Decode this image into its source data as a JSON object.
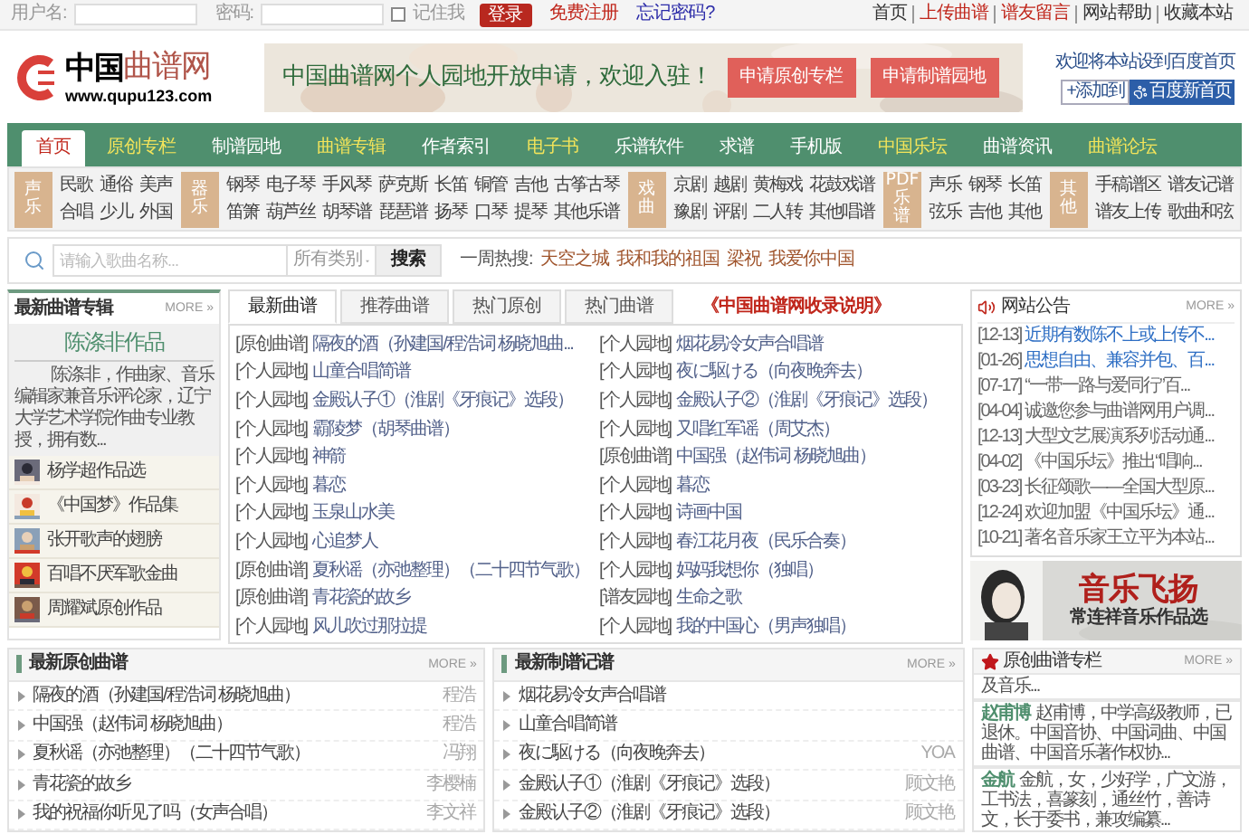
{
  "top_bar": {
    "username_label": "用户名:",
    "password_label": "密码:",
    "remember": {
      "label": "记住我",
      "checked": false
    },
    "login_button": "登录",
    "register_link": "免费注册",
    "forgot_link": "忘记密码?",
    "links": [
      {
        "label": "首页",
        "highlighted": false
      },
      {
        "label": "上传曲谱",
        "highlighted": true
      },
      {
        "label": "谱友留言",
        "highlighted": true
      },
      {
        "label": "网站帮助",
        "highlighted": false
      },
      {
        "label": "收藏本站",
        "highlighted": false
      }
    ]
  },
  "header": {
    "logo": {
      "name_a": "中国",
      "name_b": "曲谱网",
      "url": "www.qupu123.com"
    },
    "banner": {
      "slogan": "中国曲谱网个人园地开放申请，欢迎入驻！",
      "buttons": [
        "申请原创专栏",
        "申请制谱园地"
      ]
    },
    "homepage": {
      "text": "欢迎将本站设到百度首页",
      "add_button": "+添加到",
      "baidu_button": "百度新首页"
    }
  },
  "nav": [
    {
      "label": "首页",
      "selected": true,
      "highlighted": false
    },
    {
      "label": "原创专栏",
      "selected": false,
      "highlighted": true
    },
    {
      "label": "制谱园地",
      "selected": false,
      "highlighted": false
    },
    {
      "label": "曲谱专辑",
      "selected": false,
      "highlighted": true
    },
    {
      "label": "作者索引",
      "selected": false,
      "highlighted": false
    },
    {
      "label": "电子书",
      "selected": false,
      "highlighted": true
    },
    {
      "label": "乐谱软件",
      "selected": false,
      "highlighted": false
    },
    {
      "label": "求谱",
      "selected": false,
      "highlighted": false
    },
    {
      "label": "手机版",
      "selected": false,
      "highlighted": false
    },
    {
      "label": "中国乐坛",
      "selected": false,
      "highlighted": true
    },
    {
      "label": "曲谱资讯",
      "selected": false,
      "highlighted": false
    },
    {
      "label": "曲谱论坛",
      "selected": false,
      "highlighted": true
    }
  ],
  "categories": [
    {
      "label": "声乐",
      "rows": [
        [
          "民歌",
          "通俗",
          "美声"
        ],
        [
          "合唱",
          "少儿",
          "外国"
        ]
      ]
    },
    {
      "label": "器乐",
      "rows": [
        [
          "钢琴",
          "电子琴",
          "手风琴",
          "萨克斯",
          "长笛",
          "铜管",
          "吉他",
          "古筝古琴"
        ],
        [
          "笛箫",
          "葫芦丝",
          "胡琴谱",
          "琵琶谱",
          "扬琴",
          "口琴",
          "提琴",
          "其他乐谱"
        ]
      ]
    },
    {
      "label": "戏曲",
      "rows": [
        [
          "京剧",
          "越剧",
          "黄梅戏",
          "花鼓戏谱"
        ],
        [
          "豫剧",
          "评剧",
          "二人转",
          "其他唱谱"
        ]
      ]
    },
    {
      "label": "PDF乐谱",
      "rows": [
        [
          "声乐",
          "钢琴",
          "长笛"
        ],
        [
          "弦乐",
          "吉他",
          "其他"
        ]
      ]
    },
    {
      "label": "其他",
      "rows": [
        [
          "手稿谱区",
          "谱友记谱"
        ],
        [
          "谱友上传",
          "歌曲和弦"
        ]
      ]
    }
  ],
  "search": {
    "placeholder": "请输入歌曲名称...",
    "category": "所有类别",
    "button": "搜索",
    "hot_label": "一周热搜:",
    "hot": [
      "天空之城",
      "我和我的祖国",
      "梁祝",
      "我爱你中国"
    ]
  },
  "album": {
    "title": "最新曲谱专辑",
    "more": "MORE »",
    "feature_title": "陈涤非作品",
    "feature_text": "陈涤非，作曲家、音乐编辑家兼音乐评论家，辽宁大学艺术学院作曲专业教授，拥有数...",
    "items": [
      "杨学超作品选",
      "《中国梦》作品集",
      "张开歌声的翅膀",
      "百唱不厌军歌金曲",
      "周耀斌原创作品"
    ]
  },
  "scores": {
    "tabs": [
      {
        "label": "最新曲谱",
        "selected": true
      },
      {
        "label": "推荐曲谱",
        "selected": false
      },
      {
        "label": "热门原创",
        "selected": false
      },
      {
        "label": "热门曲谱",
        "selected": false
      }
    ],
    "notice_link": "《中国曲谱网收录说明》",
    "columns": [
      [
        {
          "tag": "[原创曲谱]",
          "title": "隔夜的酒（孙建国/程浩词 杨晓旭曲..."
        },
        {
          "tag": "[个人园地]",
          "title": "山童合唱简谱"
        },
        {
          "tag": "[个人园地]",
          "title": "金殿认子①（淮剧《牙痕记》选段）"
        },
        {
          "tag": "[个人园地]",
          "title": "霸陵梦（胡琴曲谱）"
        },
        {
          "tag": "[个人园地]",
          "title": "神箭"
        },
        {
          "tag": "[个人园地]",
          "title": "暮恋"
        },
        {
          "tag": "[个人园地]",
          "title": "玉泉山水美"
        },
        {
          "tag": "[个人园地]",
          "title": "心追梦人"
        },
        {
          "tag": "[原创曲谱]",
          "title": "夏秋谣（亦弛整理）（二十四节气歌）"
        },
        {
          "tag": "[原创曲谱]",
          "title": "青花瓷的故乡"
        },
        {
          "tag": "[个人园地]",
          "title": "风儿吹过那拉提"
        }
      ],
      [
        {
          "tag": "[个人园地]",
          "title": "烟花易冷女声合唱谱"
        },
        {
          "tag": "[个人园地]",
          "title": "夜に駆ける（向夜晚奔去）"
        },
        {
          "tag": "[个人园地]",
          "title": "金殿认子②（淮剧《牙痕记》选段）"
        },
        {
          "tag": "[个人园地]",
          "title": "又唱红军谣（周艾杰）"
        },
        {
          "tag": "[原创曲谱]",
          "title": "中国强（赵伟词 杨晓旭曲）"
        },
        {
          "tag": "[个人园地]",
          "title": "暮恋"
        },
        {
          "tag": "[个人园地]",
          "title": "诗画中国"
        },
        {
          "tag": "[个人园地]",
          "title": "春江花月夜（民乐合奏）"
        },
        {
          "tag": "[个人园地]",
          "title": "妈妈我想你（独唱）"
        },
        {
          "tag": "[谱友园地]",
          "title": "生命之歌"
        },
        {
          "tag": "[个人园地]",
          "title": "我的中国心（男声独唱）"
        }
      ]
    ]
  },
  "announcements": {
    "title": "网站公告",
    "more": "MORE »",
    "items": [
      {
        "date": "[12-13]",
        "title": "近期有数陈不上或上传不...",
        "highlighted": true
      },
      {
        "date": "[01-26]",
        "title": "思想自由、兼容并包、百...",
        "highlighted": true
      },
      {
        "date": "[07-17]",
        "title": "“一带一路与爱同行”百...",
        "highlighted": false
      },
      {
        "date": "[04-04]",
        "title": "诚邀您参与曲谱网用户调...",
        "highlighted": false
      },
      {
        "date": "[12-13]",
        "title": "大型文艺展演系列活动通...",
        "highlighted": false
      },
      {
        "date": "[04-02]",
        "title": "《中国乐坛》推出“唱响...",
        "highlighted": false
      },
      {
        "date": "[03-23]",
        "title": "长征颂歌——全国大型原...",
        "highlighted": false
      },
      {
        "date": "[12-24]",
        "title": "欢迎加盟《中国乐坛》通...",
        "highlighted": false
      },
      {
        "date": "[10-21]",
        "title": "著名音乐家王立平为本站...",
        "highlighted": false
      }
    ],
    "ad": {
      "title": "音乐飞扬",
      "subtitle": "常连祥音乐作品选"
    }
  },
  "latest_original": {
    "title": "最新原创曲谱",
    "more": "MORE »",
    "rows": [
      {
        "title": "隔夜的酒（孙建国/程浩词 杨晓旭曲）",
        "author": "程浩"
      },
      {
        "title": "中国强（赵伟词 杨晓旭曲）",
        "author": "程浩"
      },
      {
        "title": "夏秋谣（亦弛整理）（二十四节气歌）",
        "author": "冯翔"
      },
      {
        "title": "青花瓷的故乡",
        "author": "李樱楠"
      },
      {
        "title": "我的祝福你听见了吗（女声合唱）",
        "author": "李文祥"
      }
    ]
  },
  "latest_transcribed": {
    "title": "最新制谱记谱",
    "more": "MORE »",
    "rows": [
      {
        "title": "烟花易冷女声合唱谱"
      },
      {
        "title": "山童合唱简谱"
      },
      {
        "title": "夜に駆ける（向夜晚奔去）",
        "author": "YOA"
      },
      {
        "title": "金殿认子①（淮剧《牙痕记》选段）",
        "author": "顾文艳"
      },
      {
        "title": "金殿认子②（淮剧《牙痕记》选段）",
        "author": "顾文艳"
      }
    ]
  },
  "columnists": {
    "title": "原创曲谱专栏",
    "more": "MORE »",
    "entries": [
      {
        "text": "及音乐..."
      },
      {
        "name": "赵甫博",
        "text": "赵甫博，中学高级教师，已退休。中国音协、中国词曲、中国曲谱、中国音乐著作权协..."
      },
      {
        "name": "金航",
        "text": "金航，女，少好学，广文游，工书法，喜篆刻，通丝竹，善诗文，长于委书，兼攻编纂..."
      }
    ]
  }
}
